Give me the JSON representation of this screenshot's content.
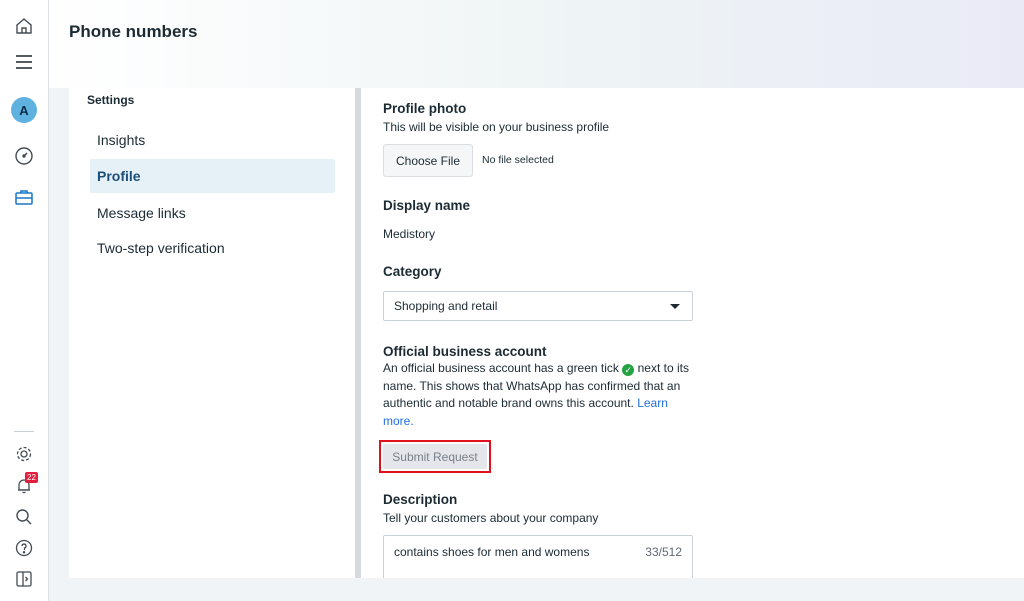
{
  "rail": {
    "avatar_initial": "A",
    "notification_count": "22",
    "icons": [
      "home-icon",
      "menu-icon",
      "gauge-icon",
      "briefcase-icon",
      "gear-icon",
      "bell-icon",
      "search-icon",
      "help-icon",
      "sidebar-toggle-icon"
    ]
  },
  "header": {
    "title": "Phone numbers"
  },
  "settings": {
    "title": "Settings",
    "items": [
      {
        "label": "Insights",
        "active": false
      },
      {
        "label": "Profile",
        "active": true
      },
      {
        "label": "Message links",
        "active": false
      },
      {
        "label": "Two-step verification",
        "active": false
      }
    ]
  },
  "profile_photo": {
    "heading": "Profile photo",
    "hint": "This will be visible on your business profile",
    "button_label": "Choose File",
    "file_status": "No file selected"
  },
  "display_name": {
    "heading": "Display name",
    "value": "Medistory"
  },
  "category": {
    "heading": "Category",
    "selected": "Shopping and retail"
  },
  "official_account": {
    "heading": "Official business account",
    "text_before_tick": "An official business account has a green tick",
    "text_after_tick": "next to its name. This shows that WhatsApp has confirmed that an authentic and notable brand owns this account.",
    "link_label": "Learn more.",
    "submit_label": "Submit Request"
  },
  "description": {
    "heading": "Description",
    "hint": "Tell your customers about your company",
    "value": "contains shoes for men and womens",
    "counter": "33/512"
  },
  "colors": {
    "accent_link": "#216fdb",
    "highlight_border": "#e0111c",
    "tick_green": "#25a244"
  }
}
